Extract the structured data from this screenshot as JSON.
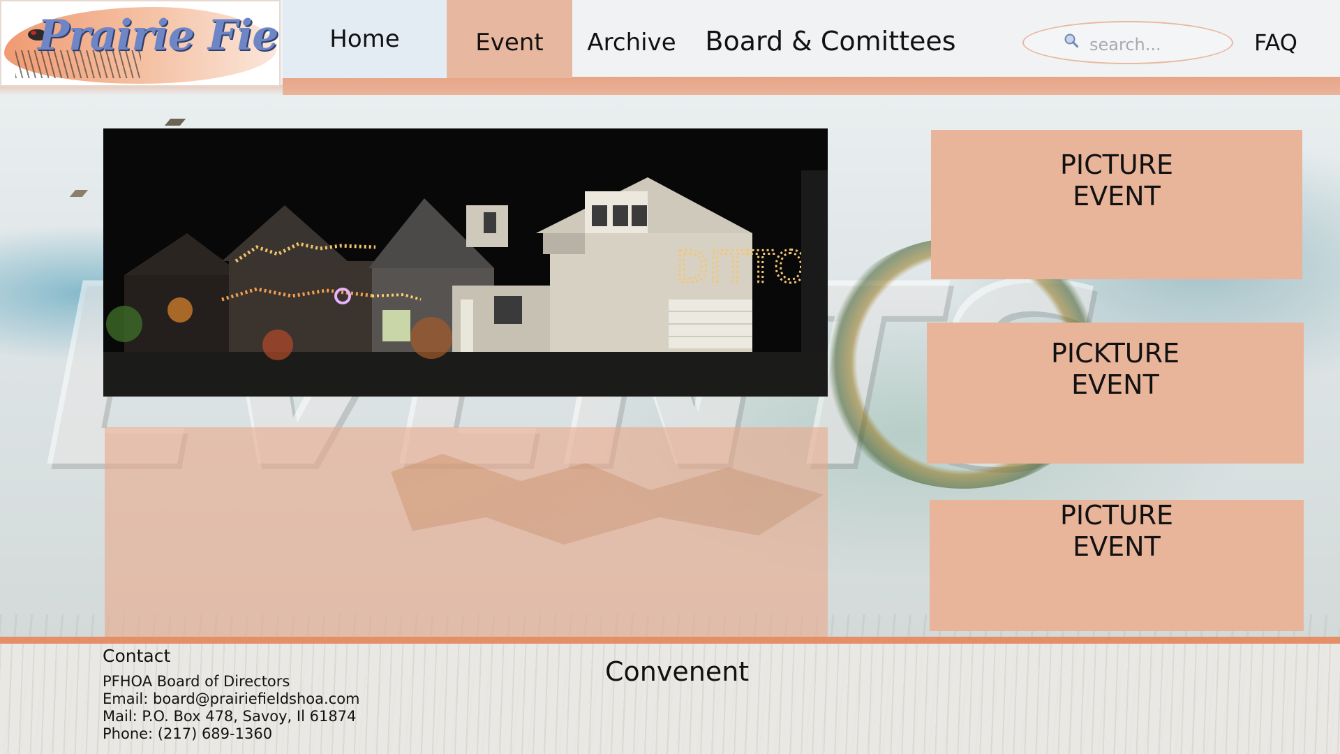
{
  "colors": {
    "accent_peach": "#e8b49a",
    "nav_active": "#e8b7a0",
    "header_strip": "#e7a182",
    "footer_line": "#e48f68",
    "logo_text": "#6f86c6"
  },
  "logo": {
    "text": "Prairie Fields"
  },
  "nav": {
    "home": "Home",
    "event": "Event",
    "archive": "Archive",
    "board": "Board & Comittees",
    "faq": "FAQ",
    "active": "Event"
  },
  "search": {
    "placeholder": "search...",
    "icon": "search-icon"
  },
  "hero": {
    "sign_text": "DITTO"
  },
  "cards": [
    {
      "line1": "PICTURE",
      "line2": "EVENT"
    },
    {
      "line1": "PICKTURE",
      "line2": "EVENT"
    },
    {
      "line1": "PICTURE",
      "line2": "EVENT"
    }
  ],
  "footer": {
    "contact_title": "Contact",
    "org": "PFHOA Board of Directors",
    "email": "Email: board@prairiefieldshoa.com",
    "mail": "Mail: P.O. Box 478, Savoy, Il  61874",
    "phone": "Phone: (217) 689-1360",
    "convenent": "Convenent"
  }
}
